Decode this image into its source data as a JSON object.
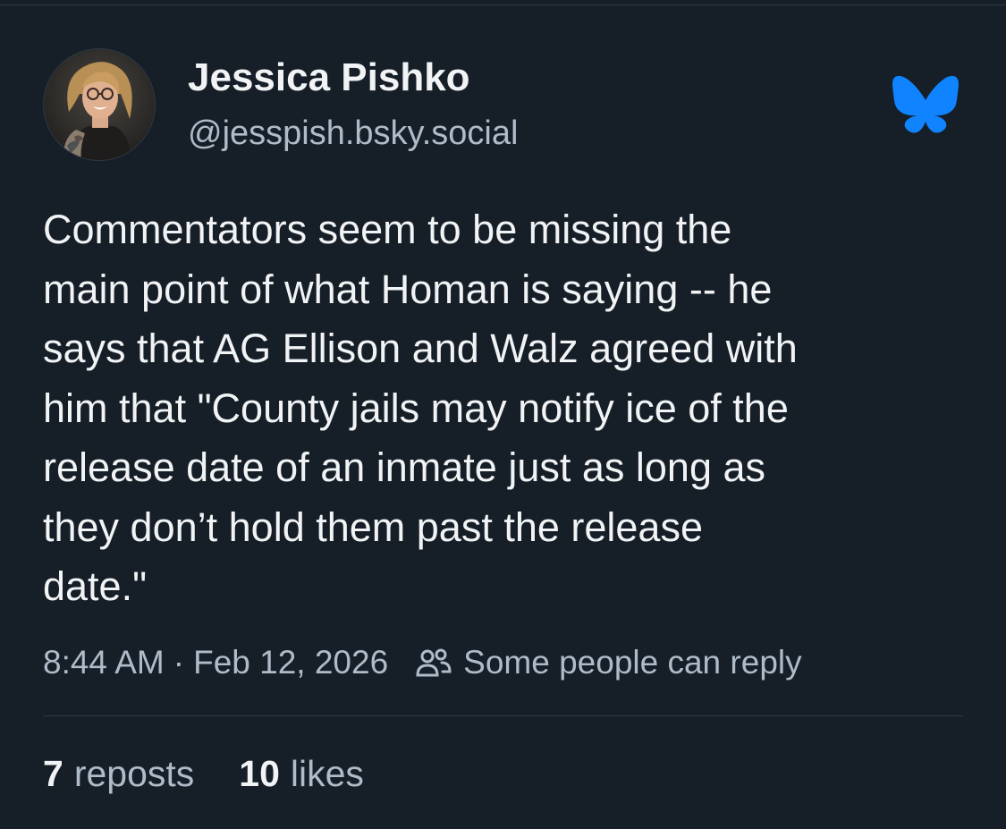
{
  "author": {
    "display_name": "Jessica Pishko",
    "handle": "@jesspish.bsky.social"
  },
  "post": {
    "lines": [
      "Commentators seem to be missing the",
      "main point of what Homan is saying -- he",
      "says that AG Ellison and Walz agreed with",
      "him that \"County jails may notify ice of the",
      "release date of an inmate just as long as",
      "they don’t hold them past the release",
      "date.\""
    ],
    "time": "8:44 AM",
    "separator": "·",
    "date": "Feb 12, 2026",
    "reply_setting": "Some people can reply"
  },
  "stats": {
    "reposts_count": "7",
    "reposts_label": "reposts",
    "likes_count": "10",
    "likes_label": "likes"
  },
  "icons": {
    "logo": "bluesky-butterfly-icon",
    "reply": "people-icon"
  },
  "colors": {
    "background": "#161e27",
    "text": "#f1f3f5",
    "muted": "#aebbc9",
    "brand": "#1083fe",
    "divider": "#2e3a47"
  }
}
